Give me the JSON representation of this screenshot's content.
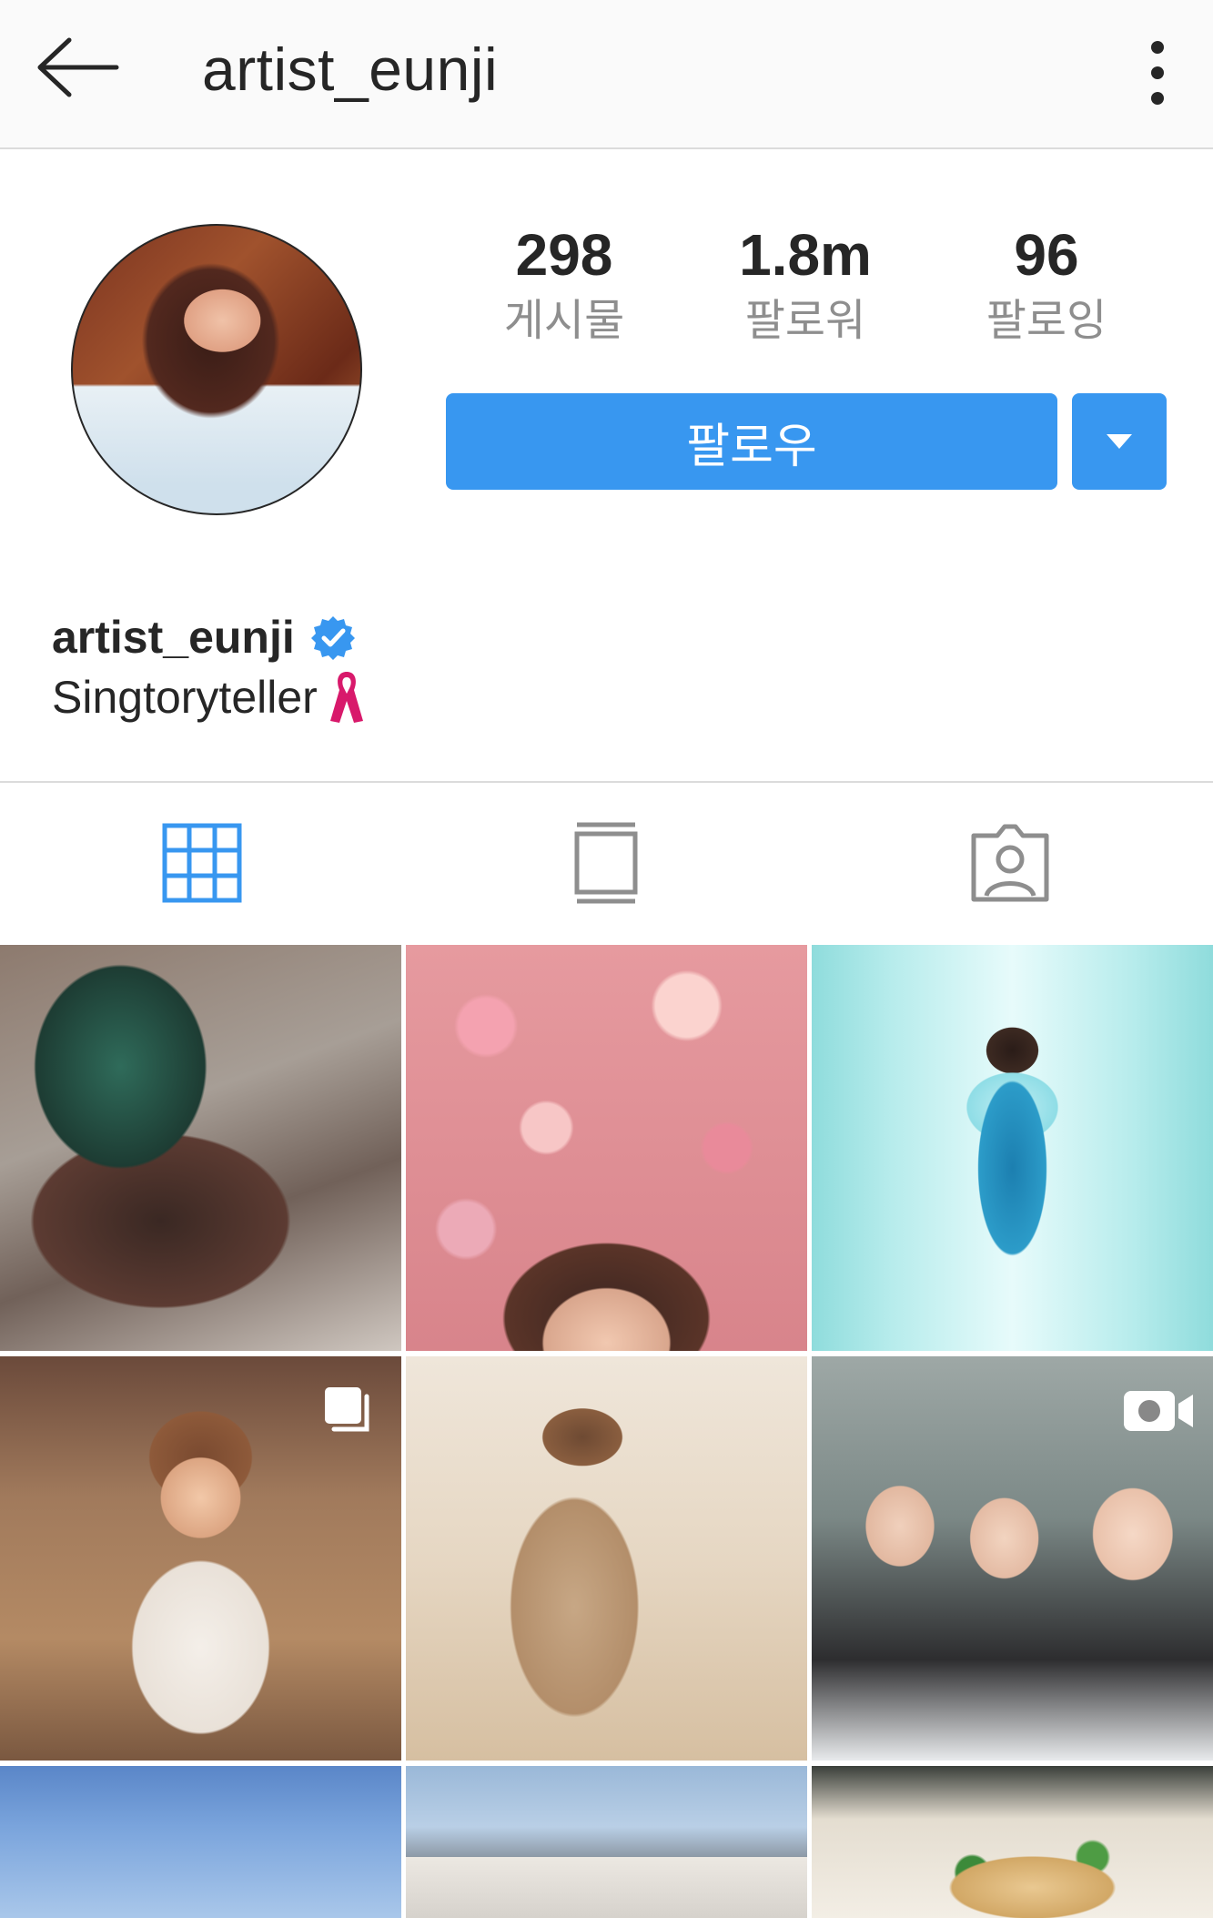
{
  "header": {
    "title": "artist_eunji"
  },
  "profile": {
    "stats": [
      {
        "value": "298",
        "label": "게시물"
      },
      {
        "value": "1.8m",
        "label": "팔로워"
      },
      {
        "value": "96",
        "label": "팔로잉"
      }
    ],
    "follow_label": "팔로우",
    "username": "artist_eunji",
    "bio": "Singtoryteller"
  },
  "colors": {
    "accent": "#3897f0",
    "verified": "#3897f0",
    "ribbon": "#d8196b"
  },
  "tabs": [
    {
      "name": "grid",
      "icon": "grid-icon",
      "active": true
    },
    {
      "name": "feed",
      "icon": "single-post-icon",
      "active": false
    },
    {
      "name": "tagged",
      "icon": "tagged-user-icon",
      "active": false
    }
  ],
  "posts": [
    {
      "overlay": ""
    },
    {
      "overlay": ""
    },
    {
      "overlay": ""
    },
    {
      "overlay": "carousel-icon"
    },
    {
      "overlay": ""
    },
    {
      "overlay": "video-icon"
    },
    {
      "overlay": ""
    },
    {
      "overlay": ""
    },
    {
      "overlay": ""
    }
  ]
}
